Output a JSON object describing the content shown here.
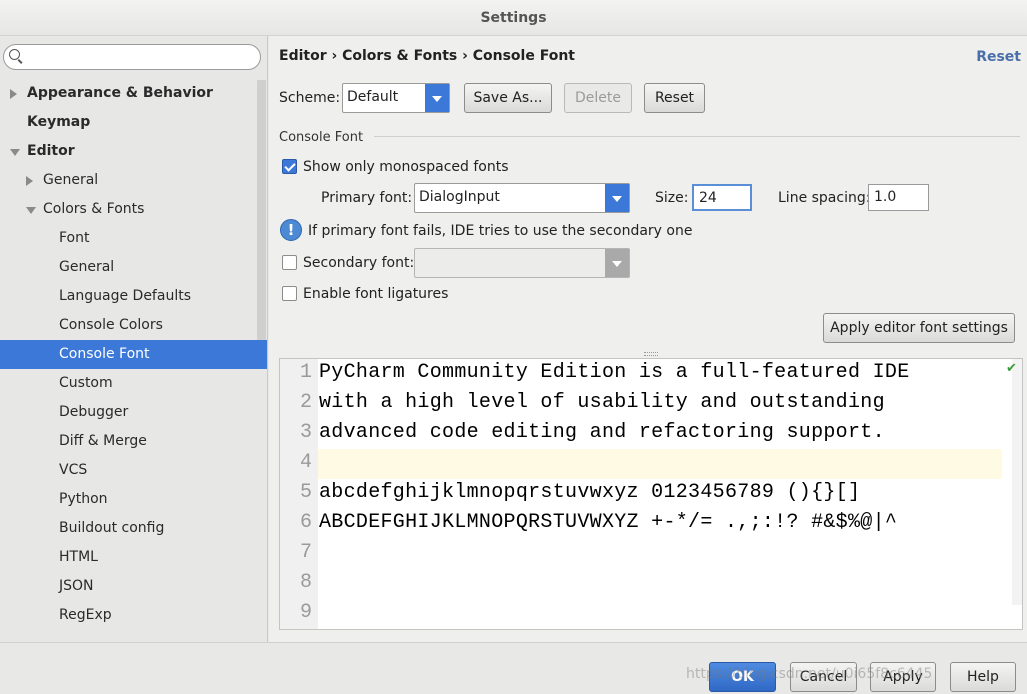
{
  "window": {
    "title": "Settings"
  },
  "search": {
    "placeholder": ""
  },
  "sidebar": {
    "items": [
      {
        "label": "Appearance & Behavior",
        "level": 0,
        "bold": true,
        "expand": "collapsed"
      },
      {
        "label": "Keymap",
        "level": 0,
        "bold": true,
        "expand": "none"
      },
      {
        "label": "Editor",
        "level": 0,
        "bold": true,
        "expand": "expanded"
      },
      {
        "label": "General",
        "level": 1,
        "bold": false,
        "expand": "collapsed"
      },
      {
        "label": "Colors & Fonts",
        "level": 1,
        "bold": false,
        "expand": "expanded"
      },
      {
        "label": "Font",
        "level": 2,
        "bold": false,
        "expand": "none"
      },
      {
        "label": "General",
        "level": 2,
        "bold": false,
        "expand": "none"
      },
      {
        "label": "Language Defaults",
        "level": 2,
        "bold": false,
        "expand": "none"
      },
      {
        "label": "Console Colors",
        "level": 2,
        "bold": false,
        "expand": "none"
      },
      {
        "label": "Console Font",
        "level": 2,
        "bold": false,
        "expand": "none",
        "selected": true
      },
      {
        "label": "Custom",
        "level": 2,
        "bold": false,
        "expand": "none"
      },
      {
        "label": "Debugger",
        "level": 2,
        "bold": false,
        "expand": "none"
      },
      {
        "label": "Diff & Merge",
        "level": 2,
        "bold": false,
        "expand": "none"
      },
      {
        "label": "VCS",
        "level": 2,
        "bold": false,
        "expand": "none"
      },
      {
        "label": "Python",
        "level": 2,
        "bold": false,
        "expand": "none"
      },
      {
        "label": "Buildout config",
        "level": 2,
        "bold": false,
        "expand": "none"
      },
      {
        "label": "HTML",
        "level": 2,
        "bold": false,
        "expand": "none"
      },
      {
        "label": "JSON",
        "level": 2,
        "bold": false,
        "expand": "none"
      },
      {
        "label": "RegExp",
        "level": 2,
        "bold": false,
        "expand": "none"
      }
    ]
  },
  "header": {
    "breadcrumb": "Editor › Colors & Fonts › Console Font",
    "reset_link": "Reset"
  },
  "scheme": {
    "label": "Scheme:",
    "value": "Default",
    "save_as": "Save As...",
    "delete": "Delete",
    "reset": "Reset"
  },
  "console_font": {
    "section_title": "Console Font",
    "show_mono_label": "Show only monospaced fonts",
    "show_mono_checked": true,
    "primary_label": "Primary font:",
    "primary_value": "DialogInput",
    "size_label": "Size:",
    "size_value": "24",
    "line_spacing_label": "Line spacing:",
    "line_spacing_value": "1.0",
    "info_text": "If primary font fails, IDE tries to use the secondary one",
    "secondary_label": "Secondary font:",
    "secondary_checked": false,
    "secondary_value": "",
    "ligatures_label": "Enable font ligatures",
    "ligatures_checked": false,
    "apply_editor_btn": "Apply editor font settings"
  },
  "preview": {
    "line_numbers": [
      "1",
      "2",
      "3",
      "4",
      "5",
      "6",
      "7",
      "8",
      "9"
    ],
    "lines": [
      "PyCharm Community Edition is a full-featured IDE",
      "with a high level of usability and outstanding",
      "advanced code editing and refactoring support.",
      "",
      "abcdefghijklmnopqrstuvwxyz 0123456789 (){}[]",
      "ABCDEFGHIJKLMNOPQRSTUVWXYZ +-*/= .,;:!? #&$%@|^",
      "",
      "",
      ""
    ],
    "current_line": 4
  },
  "footer": {
    "ok": "OK",
    "cancel": "Cancel",
    "apply": "Apply",
    "help": "Help",
    "watermark": "https://blog.csdn.net/u0i65f8c6445"
  }
}
